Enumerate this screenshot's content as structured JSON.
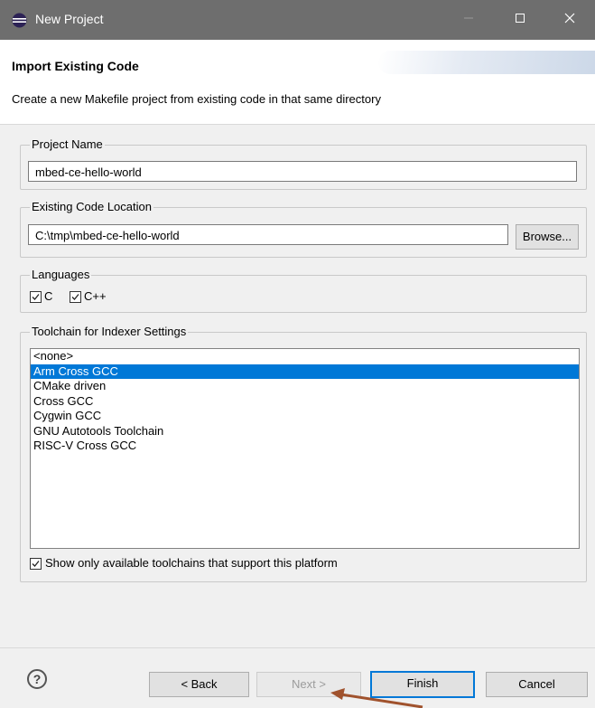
{
  "window": {
    "title": "New Project"
  },
  "banner": {
    "heading": "Import Existing Code",
    "description": "Create a new Makefile project from existing code in that same directory"
  },
  "project_name": {
    "legend": "Project Name",
    "value": "mbed-ce-hello-world"
  },
  "code_location": {
    "legend": "Existing Code Location",
    "value": "C:\\tmp\\mbed-ce-hello-world",
    "browse_label": "Browse..."
  },
  "languages": {
    "legend": "Languages",
    "options": [
      {
        "label": "C",
        "checked": true
      },
      {
        "label": "C++",
        "checked": true
      }
    ]
  },
  "toolchain": {
    "legend": "Toolchain for Indexer Settings",
    "items": [
      "<none>",
      "Arm Cross GCC",
      "CMake driven",
      "Cross GCC",
      "Cygwin GCC",
      "GNU Autotools Toolchain",
      "RISC-V Cross GCC"
    ],
    "selected": "Arm Cross GCC",
    "filter_label": "Show only available toolchains that support this platform",
    "filter_checked": true
  },
  "buttons": {
    "help_glyph": "?",
    "back_label": "< Back",
    "next_label": "Next >",
    "finish_label": "Finish",
    "cancel_label": "Cancel"
  },
  "colors": {
    "selection": "#0078d7",
    "titlebar": "#6e6e6e",
    "arrow": "#a0522d"
  }
}
